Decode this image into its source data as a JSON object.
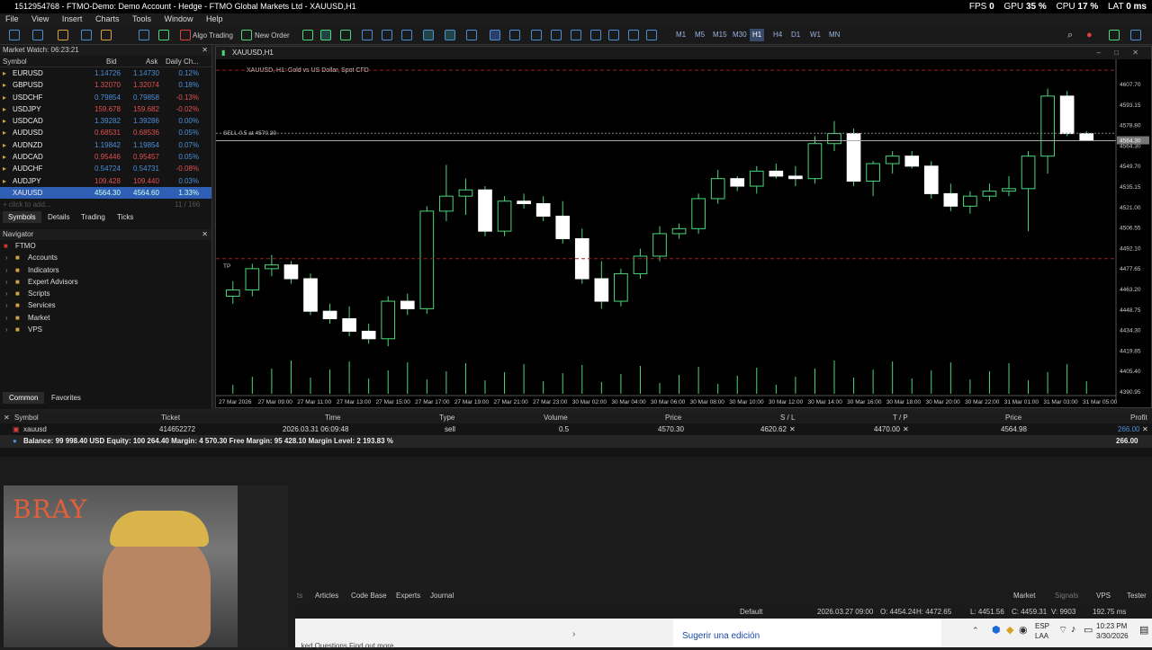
{
  "titlebar": {
    "title": "1512954768 - FTMO-Demo: Demo Account - Hedge - FTMO Global Markets Ltd - XAUUSD,H1",
    "fps_label": "FPS",
    "fps": "0",
    "gpu_label": "GPU",
    "gpu": "35 %",
    "cpu_label": "CPU",
    "cpu": "17 %",
    "lat_label": "LAT",
    "lat": "0 ms"
  },
  "menu": [
    "File",
    "View",
    "Insert",
    "Charts",
    "Tools",
    "Window",
    "Help"
  ],
  "toolbar": {
    "algo": "Algo Trading",
    "new_order": "New Order",
    "timeframes": [
      "M1",
      "M5",
      "M15",
      "M30",
      "H1",
      "H4",
      "D1",
      "W1",
      "MN"
    ],
    "active_tf": "H1"
  },
  "market_watch": {
    "title": "Market Watch: 06:23:21",
    "cols": [
      "Symbol",
      "Bid",
      "Ask",
      "Daily Ch..."
    ],
    "rows": [
      {
        "s": "EURUSD",
        "b": "1.14726",
        "a": "1.14730",
        "d": "0.12%"
      },
      {
        "s": "GBPUSD",
        "b": "1.32070",
        "a": "1.32074",
        "d": "0.18%"
      },
      {
        "s": "USDCHF",
        "b": "0.79854",
        "a": "0.79858",
        "d": "-0.13%"
      },
      {
        "s": "USDJPY",
        "b": "159.678",
        "a": "159.682",
        "d": "-0.02%"
      },
      {
        "s": "USDCAD",
        "b": "1.39282",
        "a": "1.39286",
        "d": "0.00%"
      },
      {
        "s": "AUDUSD",
        "b": "0.68531",
        "a": "0.68536",
        "d": "0.05%"
      },
      {
        "s": "AUDNZD",
        "b": "1.19842",
        "a": "1.19854",
        "d": "0.07%"
      },
      {
        "s": "AUDCAD",
        "b": "0.95446",
        "a": "0.95457",
        "d": "0.05%"
      },
      {
        "s": "AUDCHF",
        "b": "0.54724",
        "a": "0.54731",
        "d": "-0.08%"
      },
      {
        "s": "AUDJPY",
        "b": "109.428",
        "a": "109.440",
        "d": "0.03%"
      },
      {
        "s": "XAUUSD",
        "b": "4564.30",
        "a": "4564.60",
        "d": "1.33%"
      }
    ],
    "add": "+ click to add...",
    "count": "11 / 166",
    "tabs": [
      "Symbols",
      "Details",
      "Trading",
      "Ticks"
    ]
  },
  "navigator": {
    "title": "Navigator",
    "root": "FTMO",
    "items": [
      "Accounts",
      "Indicators",
      "Expert Advisors",
      "Scripts",
      "Services",
      "Market",
      "VPS"
    ],
    "tabs": [
      "Common",
      "Favorites"
    ]
  },
  "chart": {
    "window_title": "XAUUSD,H1",
    "info": "XAUUSD, H1:  Gold vs US Dollar, Spot CFD",
    "sell_label": "SELL 0.5  at 4570.30",
    "tp_label": "TP",
    "current_price_label": "4564.30",
    "price_ticks": [
      "4607.70",
      "4593.15",
      "4578.80",
      "4564.30",
      "4549.70",
      "4535.15",
      "4521.00",
      "4506.55",
      "4492.10",
      "4477.65",
      "4463.20",
      "4448.75",
      "4434.30",
      "4419.85",
      "4405.40",
      "4390.95"
    ],
    "time_ticks": [
      "27 Mar 2026",
      "27 Mar 09:00",
      "27 Mar 11:00",
      "27 Mar 13:00",
      "27 Mar 15:00",
      "27 Mar 17:00",
      "27 Mar 19:00",
      "27 Mar 21:00",
      "27 Mar 23:00",
      "30 Mar 02:00",
      "30 Mar 04:00",
      "30 Mar 06:00",
      "30 Mar 08:00",
      "30 Mar 10:00",
      "30 Mar 12:00",
      "30 Mar 14:00",
      "30 Mar 16:00",
      "30 Mar 18:00",
      "30 Mar 20:00",
      "30 Mar 22:00",
      "31 Mar 01:00",
      "31 Mar 03:00",
      "31 Mar 05:00"
    ]
  },
  "chart_data": {
    "type": "candlestick",
    "ylim": [
      4385,
      4615
    ],
    "sell_price": 4570.3,
    "sl_price": 4620.62,
    "tp_price": 4470.0,
    "current_price": 4564.3,
    "candles": [
      [
        4440,
        4452,
        4434,
        4445
      ],
      [
        4445,
        4466,
        4440,
        4462
      ],
      [
        4462,
        4473,
        4456,
        4465
      ],
      [
        4465,
        4468,
        4450,
        4454
      ],
      [
        4454,
        4458,
        4425,
        4428
      ],
      [
        4428,
        4434,
        4418,
        4422
      ],
      [
        4422,
        4432,
        4408,
        4412
      ],
      [
        4412,
        4418,
        4402,
        4406
      ],
      [
        4406,
        4440,
        4400,
        4436
      ],
      [
        4436,
        4442,
        4425,
        4430
      ],
      [
        4430,
        4512,
        4426,
        4508
      ],
      [
        4508,
        4545,
        4500,
        4520
      ],
      [
        4520,
        4534,
        4505,
        4525
      ],
      [
        4525,
        4528,
        4488,
        4492
      ],
      [
        4492,
        4520,
        4488,
        4516
      ],
      [
        4516,
        4522,
        4510,
        4514
      ],
      [
        4514,
        4520,
        4500,
        4504
      ],
      [
        4504,
        4516,
        4482,
        4486
      ],
      [
        4486,
        4494,
        4450,
        4454
      ],
      [
        4454,
        4468,
        4430,
        4436
      ],
      [
        4436,
        4462,
        4432,
        4458
      ],
      [
        4458,
        4478,
        4454,
        4472
      ],
      [
        4472,
        4496,
        4468,
        4490
      ],
      [
        4490,
        4498,
        4486,
        4494
      ],
      [
        4494,
        4522,
        4490,
        4518
      ],
      [
        4518,
        4541,
        4514,
        4534
      ],
      [
        4534,
        4536,
        4524,
        4528
      ],
      [
        4528,
        4544,
        4522,
        4540
      ],
      [
        4540,
        4546,
        4534,
        4536
      ],
      [
        4536,
        4544,
        4528,
        4534
      ],
      [
        4534,
        4568,
        4530,
        4562
      ],
      [
        4562,
        4580,
        4556,
        4570
      ],
      [
        4570,
        4574,
        4528,
        4532
      ],
      [
        4532,
        4548,
        4520,
        4546
      ],
      [
        4546,
        4556,
        4538,
        4552
      ],
      [
        4552,
        4556,
        4542,
        4544
      ],
      [
        4544,
        4548,
        4518,
        4522
      ],
      [
        4522,
        4530,
        4508,
        4512
      ],
      [
        4512,
        4524,
        4506,
        4520
      ],
      [
        4520,
        4530,
        4516,
        4524
      ],
      [
        4524,
        4536,
        4520,
        4526
      ],
      [
        4526,
        4556,
        4492,
        4552
      ],
      [
        4552,
        4606,
        4538,
        4600
      ],
      [
        4600,
        4604,
        4568,
        4570
      ],
      [
        4570,
        4572,
        4564,
        4564.3
      ]
    ]
  },
  "trades": {
    "cols": [
      "Symbol",
      "Ticket",
      "Time",
      "Type",
      "Volume",
      "Price",
      "S / L",
      "T / P",
      "Price",
      "Profit"
    ],
    "row": {
      "symbol": "xauusd",
      "ticket": "414652272",
      "time": "2026.03.31 06:09:48",
      "type": "sell",
      "volume": "0.5",
      "price": "4570.30",
      "sl": "4620.62",
      "tp": "4470.00",
      "cur": "4564.98",
      "profit": "266.00"
    },
    "balance": "Balance: 99 998.40 USD  Equity: 100 264.40  Margin: 4 570.30  Free Margin: 95 428.10  Margin Level: 2 193.83 %",
    "total": "266.00"
  },
  "bottom_tabs": [
    "Articles",
    "Code Base",
    "Experts",
    "Journal"
  ],
  "right_tabs": [
    "Market",
    "Signals",
    "VPS",
    "Tester"
  ],
  "status": {
    "profile": "Default",
    "time": "2026.03.27 09:00",
    "o": "O: 4454.24",
    "h": "H: 4472.65",
    "l": "L: 4451.56",
    "c": "C: 4459.31",
    "v": "V: 9903",
    "ping": "192.75 ms"
  },
  "webcam_text": "BRAY",
  "taskbar": {
    "left": "...ked Questions Find out more",
    "suggest": "Sugerir una edición",
    "lang1": "ESP",
    "lang2": "LAA",
    "clock": "10:23 PM",
    "date": "3/30/2026"
  }
}
